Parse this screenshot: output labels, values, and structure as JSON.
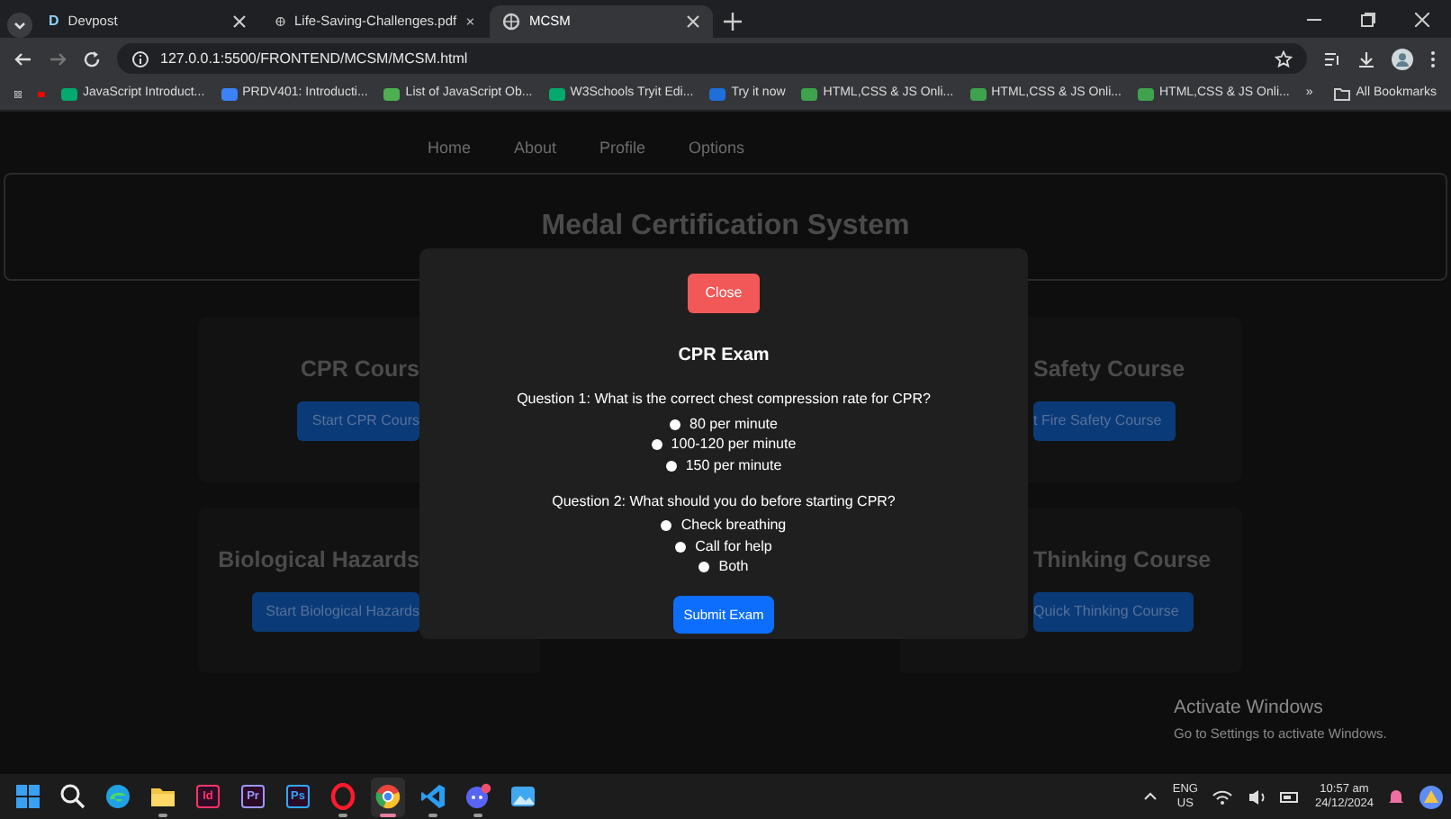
{
  "browser": {
    "tabs": [
      {
        "title": "Devpost",
        "icon_text": "D",
        "selected": false
      },
      {
        "title": "Life-Saving-Challenges.pdf",
        "selected": false
      },
      {
        "title": "MCSM",
        "selected": true
      }
    ],
    "address": "127.0.0.1:5500/FRONTEND/MCSM/MCSM.html",
    "bookmarks": [
      {
        "color": "#ff0000"
      },
      {
        "label": "JavaScript Introduct...",
        "color": "#04aa6d"
      },
      {
        "label": "PRDV401: Introducti...",
        "color": "#3b82f6"
      },
      {
        "label": "List of JavaScript Ob...",
        "color": "#4caf50"
      },
      {
        "label": "W3Schools Tryit Edi...",
        "color": "#04aa6d"
      },
      {
        "label": "Try it now",
        "color": "#1e6fd9"
      },
      {
        "label": "HTML,CSS & JS Onli...",
        "color": "#3fa34d"
      },
      {
        "label": "HTML,CSS & JS Onli...",
        "color": "#3fa34d"
      },
      {
        "label": "HTML,CSS & JS Onli...",
        "color": "#3fa34d"
      }
    ],
    "overflow": "»",
    "all_bookmarks": "All Bookmarks"
  },
  "page": {
    "nav": [
      "Home",
      "About",
      "Profile",
      "Options"
    ],
    "title": "Medal Certification System",
    "courses": [
      {
        "title": "CPR Cours",
        "button": "Start CPR Cours",
        "kind": "left"
      },
      {
        "title": "Safety Course",
        "button": "t Fire Safety Course",
        "kind": "right"
      },
      {
        "title": "Biological Hazards",
        "button": "Start Biological Hazards",
        "kind": "left"
      },
      {
        "title": "Thinking Course",
        "button": "Quick Thinking Course",
        "kind": "right"
      }
    ]
  },
  "modal": {
    "close": "Close",
    "title": "CPR Exam",
    "questions": [
      {
        "text": "Question 1: What is the correct chest compression rate for CPR?",
        "options": [
          {
            "label": "80 per minute",
            "selected": false
          },
          {
            "label": "100-120 per minute",
            "selected": false
          },
          {
            "label": "150 per minute",
            "selected": false
          }
        ]
      },
      {
        "text": "Question 2: What should you do before starting CPR?",
        "options": [
          {
            "label": "Check breathing",
            "selected": false
          },
          {
            "label": "Call for help",
            "selected": false
          },
          {
            "label": "Both",
            "selected": false
          }
        ]
      }
    ],
    "submit": "Submit Exam"
  },
  "watermark": {
    "title": "Activate Windows",
    "subtitle": "Go to Settings to activate Windows."
  },
  "taskbar": {
    "apps": [
      {
        "kind": "start",
        "running": false,
        "active": false
      },
      {
        "kind": "search",
        "running": false,
        "active": false
      },
      {
        "kind": "browser",
        "running": false,
        "active": false
      },
      {
        "kind": "folder",
        "running": true,
        "active": false
      },
      {
        "kind": "tile",
        "label": "Id",
        "color": "#ff3366",
        "running": false,
        "active": false
      },
      {
        "kind": "tile",
        "label": "Pr",
        "color": "#9999ff",
        "running": false,
        "active": false
      },
      {
        "kind": "tile",
        "label": "Ps",
        "color": "#31a8ff",
        "running": false,
        "active": false
      },
      {
        "kind": "ring",
        "running": true,
        "active": false
      },
      {
        "kind": "browser2",
        "running": true,
        "active": true
      },
      {
        "kind": "code",
        "running": true,
        "active": false
      },
      {
        "kind": "chat",
        "running": true,
        "active": false
      },
      {
        "kind": "picture",
        "running": false,
        "active": false
      }
    ],
    "language": "ENG",
    "region": "US",
    "time": "10:57 am",
    "date": "24/12/2024"
  }
}
